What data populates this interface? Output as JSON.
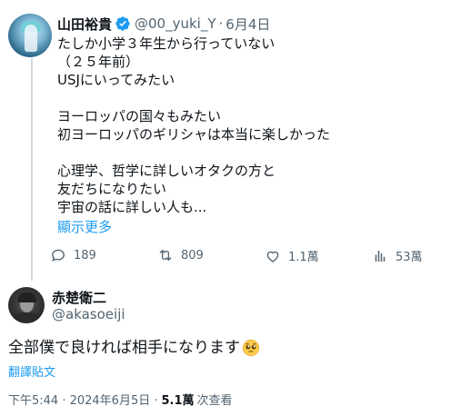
{
  "tweet": {
    "author_name": "山田裕貴",
    "handle": "@00_yuki_Y",
    "separator": "·",
    "date": "6月4日",
    "lines": [
      "たしか小学３年生から行っていない",
      "（２５年前）",
      "USJにいってみたい",
      "",
      "ヨーロッパの国々もみたい",
      "初ヨーロッパのギリシャは本当に楽しかった",
      "",
      "心理学、哲学に詳しいオタクの方と",
      "友だちになりたい",
      "宇宙の話に詳しい人も..."
    ],
    "show_more": "顯示更多",
    "stats": {
      "replies": "189",
      "reposts": "809",
      "likes": "1.1萬",
      "views": "53萬"
    }
  },
  "reply": {
    "author_name": "赤楚衛二",
    "handle": "@akasoeiji",
    "text": "全部僕で良ければ相手になります",
    "emoji": "pleading-face",
    "translate_label": "翻譯貼文",
    "timestamp": "下午5:44 · 2024年6月5日 ·",
    "views_count": "5.1萬",
    "views_label": "次查看"
  },
  "colors": {
    "text": "#0f1419",
    "secondary": "#536471",
    "link": "#1d9bf0",
    "verified": "#1d9bf0",
    "thread_line": "#cfd9de"
  }
}
